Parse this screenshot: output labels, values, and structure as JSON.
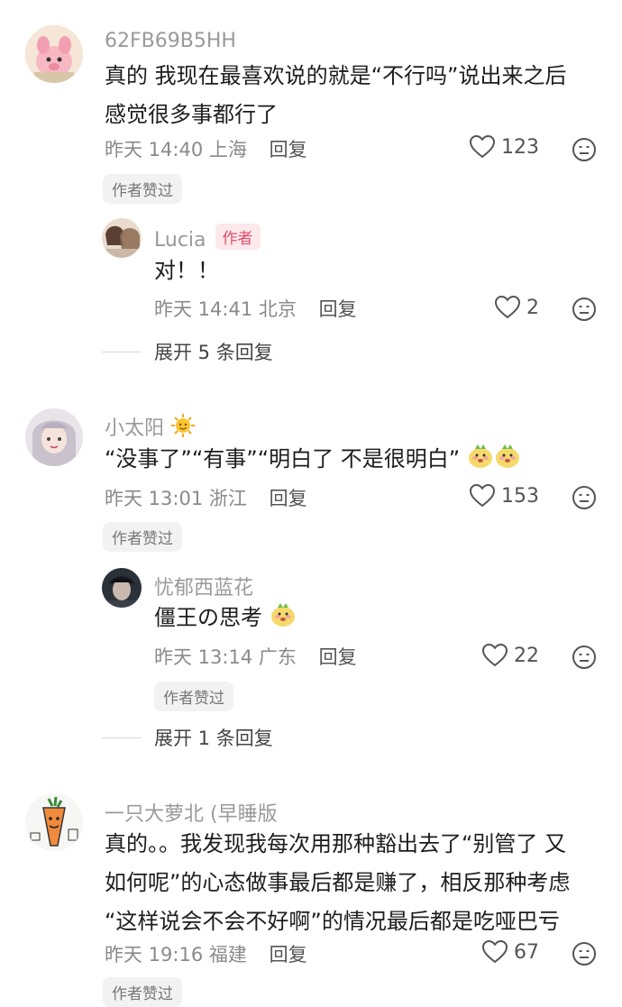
{
  "comments": [
    {
      "username": "62FB69B5HH",
      "lines": [
        "真的 我现在最喜欢说的就是“不行吗”说出来之后",
        "感觉很多事都行了"
      ],
      "time": "昨天 14:40",
      "location": "上海",
      "reply_label": "回复",
      "likes": "123",
      "badge": "作者赞过",
      "replies": [
        {
          "username": "Lucia",
          "author_tag": "作者",
          "text": "对！！",
          "time": "昨天 14:41",
          "location": "北京",
          "reply_label": "回复",
          "likes": "2"
        }
      ],
      "expand_label": "展开 5 条回复"
    },
    {
      "username": "小太阳",
      "text": "“没事了”“有事”“明白了    不是很明白”",
      "time": "昨天 13:01",
      "location": "浙江",
      "reply_label": "回复",
      "likes": "153",
      "badge": "作者赞过",
      "replies": [
        {
          "username": "忧郁西蓝花",
          "text": "僵王の思考",
          "time": "昨天 13:14",
          "location": "广东",
          "reply_label": "回复",
          "likes": "22",
          "badge": "作者赞过"
        }
      ],
      "expand_label": "展开 1 条回复"
    },
    {
      "username": "一只大萝北 (早睡版",
      "lines": [
        "真的。。我发现我每次用那种豁出去了“别管了 又",
        "如何呢”的心态做事最后都是赚了，相反那种考虑",
        "“这样说会不会不好啊”的情况最后都是吃哑巴亏"
      ],
      "time": "昨天 19:16",
      "location": "福建",
      "reply_label": "回复",
      "likes": "67",
      "badge": "作者赞过"
    }
  ]
}
